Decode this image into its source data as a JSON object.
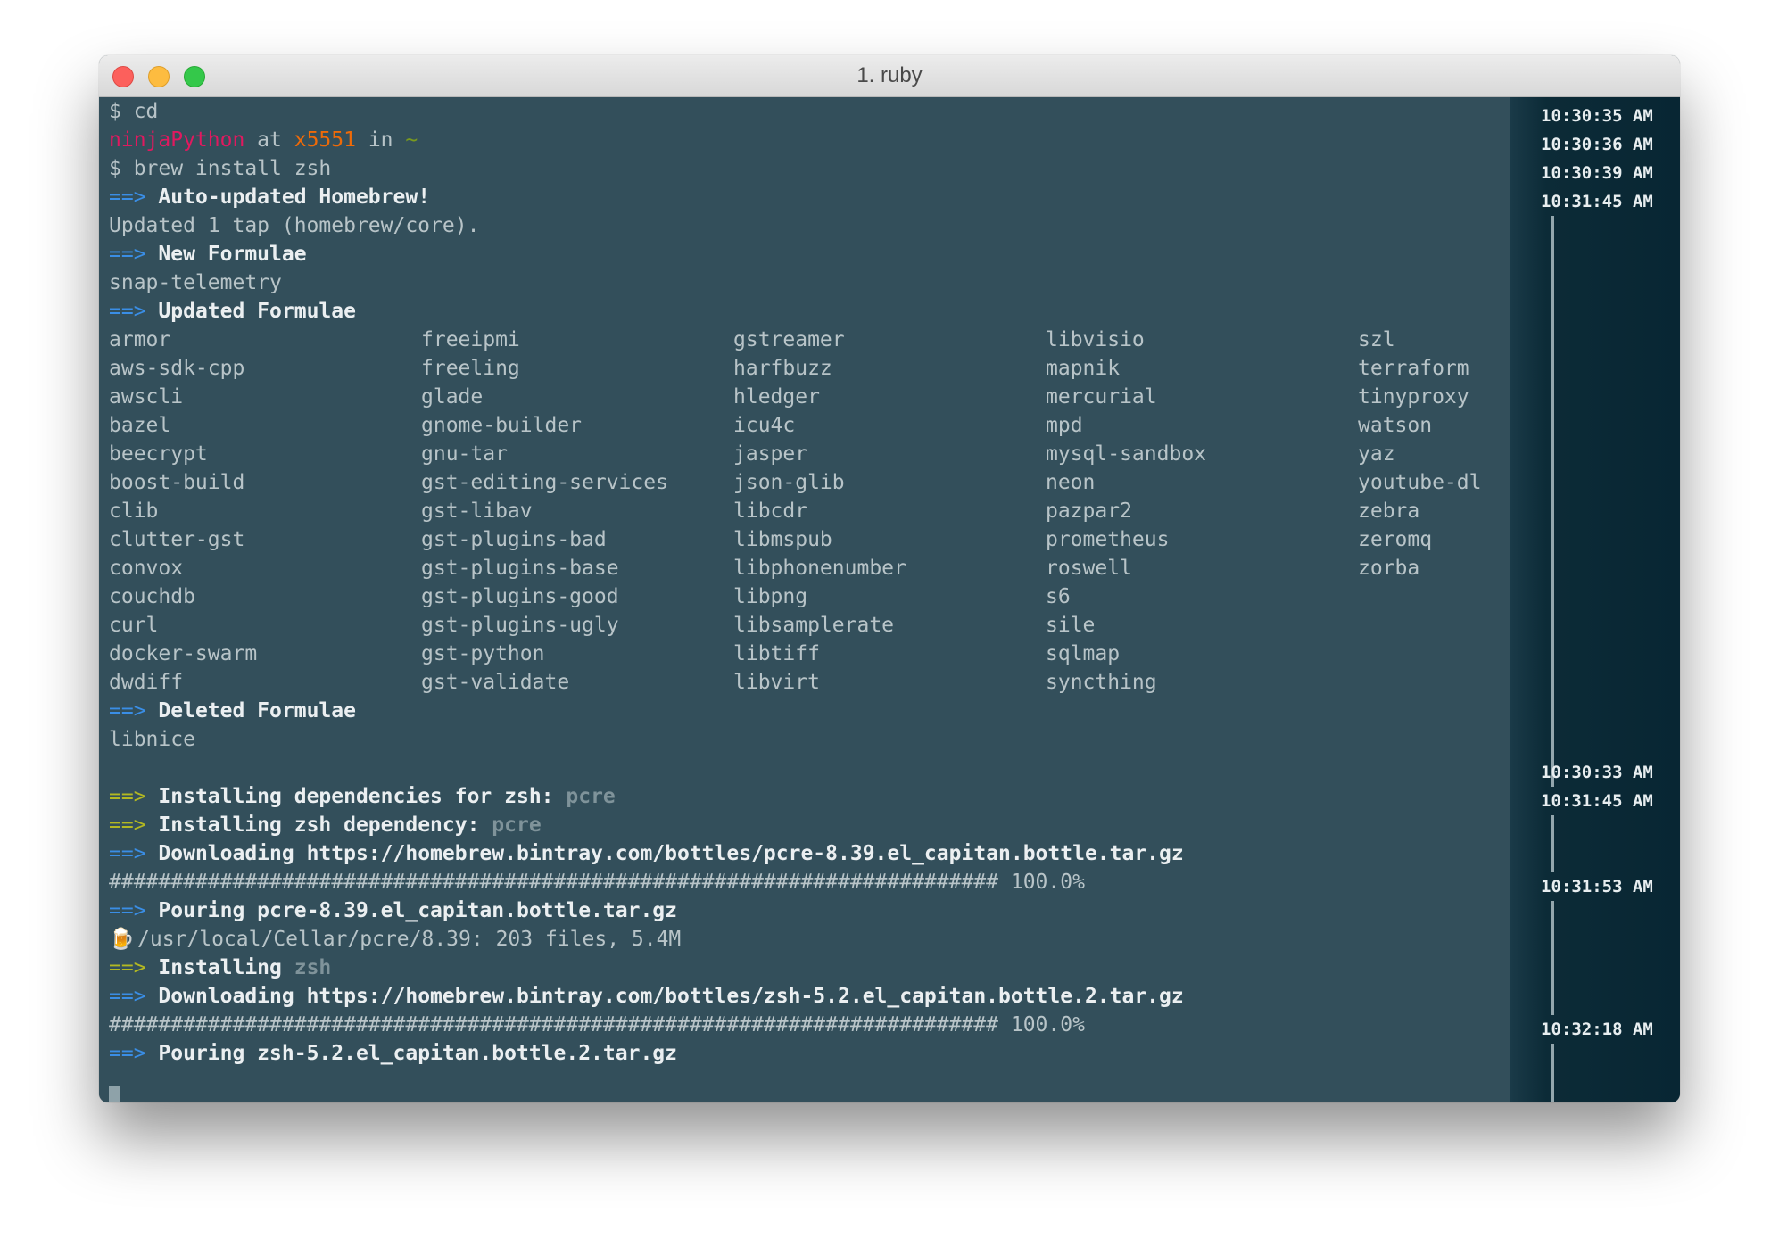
{
  "window": {
    "title": "1. ruby"
  },
  "lines": {
    "l0": "$ cd",
    "user": "ninjaPython",
    "at": " at ",
    "host": "x5551",
    "in": " in ",
    "dir": "~",
    "l2": "$ brew install zsh",
    "arrow": "==>",
    "l3": "Auto-updated Homebrew!",
    "l4": "Updated 1 tap (homebrew/core).",
    "l5": "New Formulae",
    "l6": "snap-telemetry",
    "l7": "Updated Formulae",
    "l21": "Deleted Formulae",
    "l22": "libnice",
    "l24a": "Installing dependencies for zsh: ",
    "l24b": "pcre",
    "l25a": "Installing zsh dependency: ",
    "l25b": "pcre",
    "l26": "Downloading https://homebrew.bintray.com/bottles/pcre-8.39.el_capitan.bottle.tar.gz",
    "l27": "######################################################################## 100.0%",
    "l28": "Pouring pcre-8.39.el_capitan.bottle.tar.gz",
    "beer": "🍺",
    "l29": "/usr/local/Cellar/pcre/8.39: 203 files, 5.4M",
    "l30a": "Installing ",
    "l30b": "zsh",
    "l31": "Downloading https://homebrew.bintray.com/bottles/zsh-5.2.el_capitan.bottle.2.tar.gz",
    "l32": "######################################################################## 100.0%",
    "l33": "Pouring zsh-5.2.el_capitan.bottle.2.tar.gz"
  },
  "formulae": {
    "c1": [
      "armor",
      "aws-sdk-cpp",
      "awscli",
      "bazel",
      "beecrypt",
      "boost-build",
      "clib",
      "clutter-gst",
      "convox",
      "couchdb",
      "curl",
      "docker-swarm",
      "dwdiff"
    ],
    "c2": [
      "freeipmi",
      "freeling",
      "glade",
      "gnome-builder",
      "gnu-tar",
      "gst-editing-services",
      "gst-libav",
      "gst-plugins-bad",
      "gst-plugins-base",
      "gst-plugins-good",
      "gst-plugins-ugly",
      "gst-python",
      "gst-validate"
    ],
    "c3": [
      "gstreamer",
      "harfbuzz",
      "hledger",
      "icu4c",
      "jasper",
      "json-glib",
      "libcdr",
      "libmspub",
      "libphonenumber",
      "libpng",
      "libsamplerate",
      "libtiff",
      "libvirt"
    ],
    "c4": [
      "libvisio",
      "mapnik",
      "mercurial",
      "mpd",
      "mysql-sandbox",
      "neon",
      "pazpar2",
      "prometheus",
      "roswell",
      "s6",
      "sile",
      "sqlmap",
      "syncthing"
    ],
    "c5": [
      "szl",
      "terraform",
      "tinyproxy",
      "watson",
      "yaz",
      "youtube-dl",
      "zebra",
      "zeromq",
      "zorba"
    ]
  },
  "timestamps": {
    "t1": "10:30:35 AM",
    "t2": "10:30:36 AM",
    "t3": "10:30:39 AM",
    "t4": "10:31:45 AM",
    "t5": "10:30:33 AM",
    "t6": "10:31:45 AM",
    "t7": "10:31:53 AM",
    "t8": "10:32:18 AM"
  },
  "colors": {
    "background": "#334f5b",
    "sidebar": "#082633",
    "user": "#e0195f",
    "host": "#ee6a08",
    "arrow_blue": "#3a8ee6",
    "arrow_green": "#b3b822"
  }
}
